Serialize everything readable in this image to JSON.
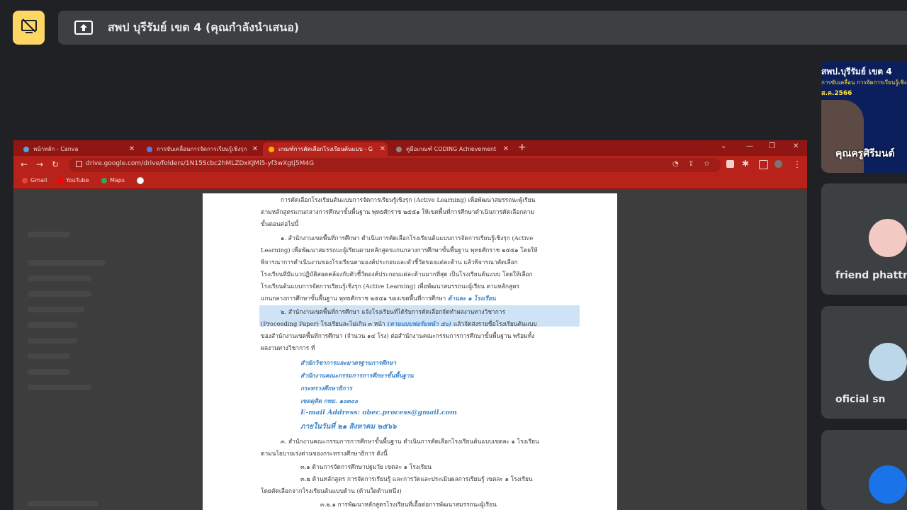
{
  "meet": {
    "presentation_title": "สพป บุรีรัมย์ เขต 4 (คุณกำลังนำเสนอ)",
    "stop_share_icon": "screen-share-off-icon",
    "present_icon": "present-to-all-icon"
  },
  "browser": {
    "tabs": [
      {
        "label": "หน้าหลัก - Canva",
        "color": "#4aa8e0"
      },
      {
        "label": "การขับเคลื่อนการจัดการเรียนรู้เชิงรุก",
        "color": "#5b7be0"
      },
      {
        "label": "เกณฑ์การคัดเลือกโรงเรียนต้นแบบ - G",
        "color": "#f4b400"
      },
      {
        "label": "คู่มือเกณฑ์ CODING Achievement",
        "color": "#888888"
      }
    ],
    "new_tab": "+",
    "url": "drive.google.com/drive/folders/1N15Scbc2hMLZDxKJMi5-yf3wXgtj5M4G",
    "bookmarks": [
      {
        "label": "Gmail",
        "color": "#ea4335"
      },
      {
        "label": "YouTube",
        "color": "#ff0000"
      },
      {
        "label": "Maps",
        "color": "#34a853"
      }
    ]
  },
  "document": {
    "lines": [
      "การคัดเลือกโรงเรียนต้นแบบการจัดการเรียนรู้เชิงรุก (Active Learning) เพื่อพัฒนาสมรรถนะผู้เรียน",
      "ตามหลักสูตรแกนกลางการศึกษาขั้นพื้นฐาน พุทธศักราช ๒๕๕๑ ให้เขตพื้นที่การศึกษาดำเนินการคัดเลือกตาม",
      "ขั้นตอนต่อไปนี้",
      "๑. สำนักงานเขตพื้นที่การศึกษา ดำเนินการคัดเลือกโรงเรียนต้นแบบการจัดการเรียนรู้เชิงรุก (Active",
      "Learning) เพื่อพัฒนาสมรรถนะผู้เรียนตามหลักสูตรแกนกลางการศึกษาขั้นพื้นฐาน พุทธศักราช ๒๕๕๑ โดยให้",
      "พิจารณาการดำเนินงานของโรงเรียนตามองค์ประกอบและตัวชี้วัดของแต่ละด้าน แล้วพิจารณาคัดเลือก",
      "โรงเรียนที่มีแนวปฏิบัติสอดคล้องกับตัวชี้วัดองค์ประกอบแต่ละด้านมากที่สุด เป็นโรงเรียนต้นแบบ โดยให้เลือก",
      "โรงเรียนต้นแบบการจัดการเรียนรู้เชิงรุก (Active Learning) เพื่อพัฒนาสมรรถนะผู้เรียน ตามหลักสูตร",
      "แกนกลางการศึกษาขั้นพื้นฐาน พุทธศักราช ๒๕๕๑ ของเขตพื้นที่การศึกษา",
      "๒. สำนักงานเขตพื้นที่การศึกษา แจ้งโรงเรียนที่ได้รับการคัดเลือกจัดทำผลงานทางวิชาการ",
      "(Proceeding Paper) โรงเรียนละไม่เกิน ๓ หน้า",
      "แล้วจัดส่งรายชื่อโรงเรียนต้นแบบ",
      "ของสำนักงานเขตพื้นที่การศึกษา (จำนวน ๑๔ โรง) ต่อสำนักงานคณะกรรมการการศึกษาขั้นพื้นฐาน พร้อมทั้ง",
      "ผลงานทางวิชาการ ที่",
      "๓. สำนักงานคณะกรรมการการศึกษาขั้นพื้นฐาน ดำเนินการคัดเลือกโรงเรียนต้นแบบเขตละ ๑ โรงเรียน",
      "ตามนโยบายเร่งด่วนของกระทรวงศึกษาธิการ ดังนี้",
      "๓.๑ ด้านการจัดการศึกษาปฐมวัย เขตละ ๑ โรงเรียน",
      "๓.๒ ด้านหลักสูตร การจัดการเรียนรู้ และการวัดและประเมินผลการเรียนรู้ เขตละ ๑ โรงเรียน",
      "โดยคัดเลือกจากโรงเรียนต้นแบบด้าน (ด้านใดด้านหนึ่ง)",
      "๓.๒.๑ การพัฒนาหลักสูตรโรงเรียนที่เอื้อต่อการพัฒนาสมรรถนะผู้เรียน"
    ],
    "blue_inline": [
      "ด้านละ ๑ โรงเรียน",
      "(ตามแบบฟอร์มหน้า ๕๐)"
    ],
    "address": [
      "สำนักวิชาการและมาตรฐานการศึกษา",
      "สำนักงานคณะกรรมการการศึกษาขั้นพื้นฐาน",
      "กระทรวงศึกษาธิการ",
      "เขตดุสิต กทม. ๑๐๓๐๐",
      "E-mail Address: obec.process@gmail.com",
      "ภายในวันที่ ๒๑ สิงหาคม ๒๕๖๖"
    ]
  },
  "participants": [
    {
      "name": "คุณครูศิรีมนต์",
      "video_title": "สพป.บุรีรัมย์ เขต 4",
      "video_sub": "การขับเคลื่อน การจัดการเรียนรู้เชิง",
      "video_year": "ส.ค.2566"
    },
    {
      "name": "friend phattr",
      "avatar_color": "#f3c9c3"
    },
    {
      "name": "oficial sn",
      "avatar_color": "#bcd6ea"
    },
    {
      "name": "",
      "avatar_color": "#1a73e8"
    }
  ]
}
